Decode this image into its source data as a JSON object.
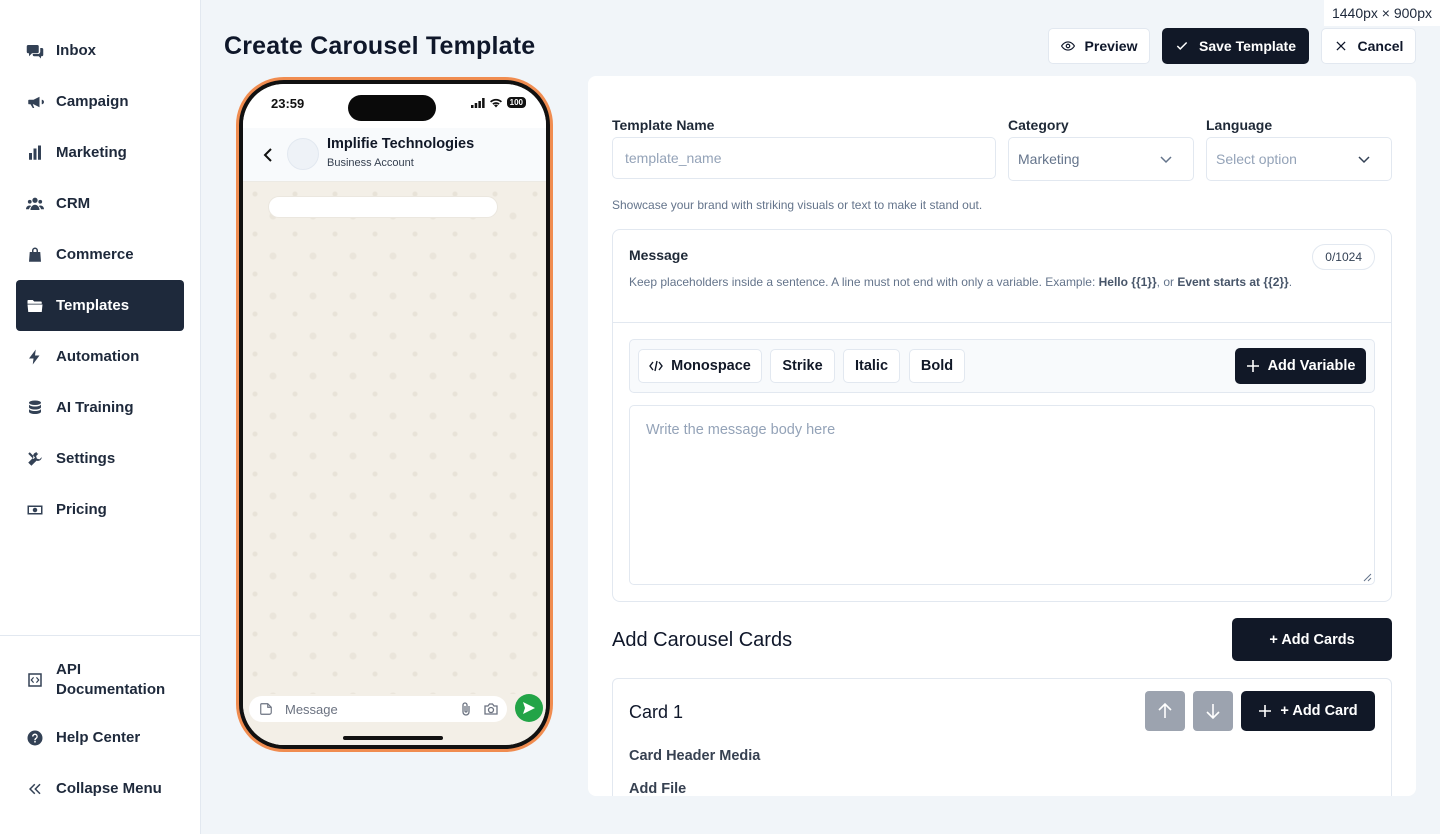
{
  "sidebar": {
    "items": [
      {
        "label": "Inbox",
        "icon": "chat-icon"
      },
      {
        "label": "Campaign",
        "icon": "megaphone-icon"
      },
      {
        "label": "Marketing",
        "icon": "bar-chart-icon"
      },
      {
        "label": "CRM",
        "icon": "users-icon"
      },
      {
        "label": "Commerce",
        "icon": "shopping-bag-icon"
      },
      {
        "label": "Templates",
        "icon": "folder-icon",
        "active": true
      },
      {
        "label": "Automation",
        "icon": "bolt-icon"
      },
      {
        "label": "AI Training",
        "icon": "database-icon"
      },
      {
        "label": "Settings",
        "icon": "tools-icon"
      },
      {
        "label": "Pricing",
        "icon": "money-icon"
      }
    ],
    "footer": [
      {
        "label": "API Documentation",
        "icon": "code-icon"
      },
      {
        "label": "Help Center",
        "icon": "help-icon"
      },
      {
        "label": "Collapse Menu",
        "icon": "double-chevron-left-icon"
      }
    ]
  },
  "viewport_badge": "1440px × 900px",
  "header": {
    "title": "Create Carousel Template",
    "preview_label": "Preview",
    "save_label": "Save Template",
    "cancel_label": "Cancel"
  },
  "phone": {
    "time": "23:59",
    "battery": "100",
    "contact_name": "Implifie Technologies",
    "contact_subtitle": "Business Account",
    "composer_placeholder": "Message"
  },
  "form": {
    "template_name_label": "Template Name",
    "template_name_placeholder": "template_name",
    "category_label": "Category",
    "category_value": "Marketing",
    "language_label": "Language",
    "language_value": "Select option",
    "helper": "Showcase your brand with striking visuals or text to make it stand out."
  },
  "message": {
    "title": "Message",
    "counter": "0/1024",
    "help_prefix": "Keep placeholders inside a sentence. A line must not end with only a variable. Example: ",
    "help_example1": "Hello {{1}}",
    "help_mid": ", or ",
    "help_example2": "Event starts at {{2}}",
    "help_suffix": ".",
    "toolbar": {
      "monospace": "Monospace",
      "strike": "Strike",
      "italic": "Italic",
      "bold": "Bold",
      "add_variable": "Add Variable"
    },
    "body_placeholder": "Write the message body here"
  },
  "carousel": {
    "title": "Add Carousel Cards",
    "add_cards_label": "+ Add Cards",
    "card": {
      "title": "Card 1",
      "add_card_label": "+ Add Card",
      "header_media_label": "Card Header Media",
      "add_file_label": "Add File"
    }
  },
  "colors": {
    "sidebar_active": "#1e293b",
    "primary_dark": "#111827",
    "phone_frame_accent": "#f08c50",
    "send_button": "#22a447"
  }
}
